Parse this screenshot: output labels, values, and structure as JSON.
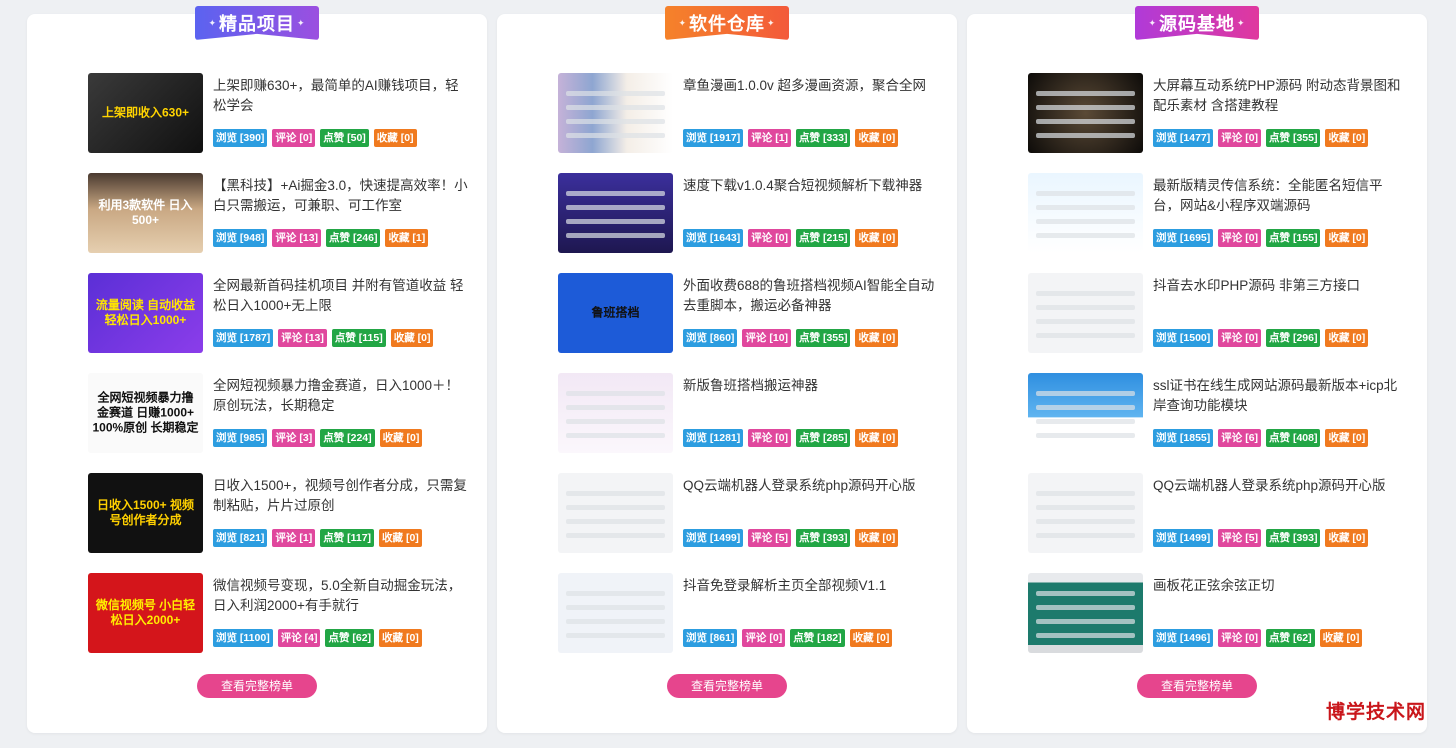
{
  "panels": [
    {
      "title": "精品项目",
      "ribbon_colors": [
        "#5b63f0",
        "#9b4fe0"
      ],
      "more_label": "查看完整榜单",
      "items": [
        {
          "title": "上架即赚630+，最简单的AI赚钱项目，轻松学会",
          "thumb_text": "上架即收入630+",
          "thumb_class": "bg-dark",
          "thumb_color": "#ffd400",
          "stats": {
            "view": "浏览 [390]",
            "comment": "评论 [0]",
            "like": "点赞 [50]",
            "fav": "收藏 [0]"
          }
        },
        {
          "title": "【黑科技】+Ai掘金3.0，快速提高效率！小白只需搬运，可兼职、可工作室",
          "thumb_text": "利用3款软件 日入500+",
          "thumb_class": "bg-desert",
          "thumb_color": "#ffffff",
          "stats": {
            "view": "浏览 [948]",
            "comment": "评论 [13]",
            "like": "点赞 [246]",
            "fav": "收藏 [1]"
          }
        },
        {
          "title": "全网最新首码挂机项目 并附有管道收益 轻松日入1000+无上限",
          "thumb_text": "流量阅读 自动收益 轻松日入1000+",
          "thumb_class": "bg-purple",
          "thumb_color": "#ffe600",
          "stats": {
            "view": "浏览 [1787]",
            "comment": "评论 [13]",
            "like": "点赞 [115]",
            "fav": "收藏 [0]"
          }
        },
        {
          "title": "全网短视频暴力撸金赛道，日入1000＋！原创玩法，长期稳定",
          "thumb_text": "全网短视频暴力撸金赛道 日赚1000+ 100%原创 长期稳定",
          "thumb_class": "bg-white",
          "thumb_color": "#111111",
          "stats": {
            "view": "浏览 [985]",
            "comment": "评论 [3]",
            "like": "点赞 [224]",
            "fav": "收藏 [0]"
          }
        },
        {
          "title": "日收入1500+，视频号创作者分成，只需复制粘贴，片片过原创",
          "thumb_text": "日收入1500+ 视频号创作者分成",
          "thumb_class": "bg-black",
          "thumb_color": "#ffd000",
          "stats": {
            "view": "浏览 [821]",
            "comment": "评论 [1]",
            "like": "点赞 [117]",
            "fav": "收藏 [0]"
          }
        },
        {
          "title": "微信视频号变现，5.0全新自动掘金玩法，日入利润2000+有手就行",
          "thumb_text": "微信视频号 小白轻松日入2000+",
          "thumb_class": "bg-red",
          "thumb_color": "#ffee00",
          "stats": {
            "view": "浏览 [1100]",
            "comment": "评论 [4]",
            "like": "点赞 [62]",
            "fav": "收藏 [0]"
          }
        }
      ]
    },
    {
      "title": "软件仓库",
      "ribbon_colors": [
        "#f5822a",
        "#f35a3a"
      ],
      "more_label": "查看完整榜单",
      "items": [
        {
          "title": "章鱼漫画1.0.0v 超多漫画资源，聚合全网",
          "thumb_text": "",
          "thumb_class": "bg-manga",
          "thumb_color": "#333333",
          "stats": {
            "view": "浏览 [1917]",
            "comment": "评论 [1]",
            "like": "点赞 [333]",
            "fav": "收藏 [0]"
          }
        },
        {
          "title": "速度下载v1.0.4聚合短视频解析下载神器",
          "thumb_text": "",
          "thumb_class": "bg-phone",
          "thumb_color": "#ffffff",
          "stats": {
            "view": "浏览 [1643]",
            "comment": "评论 [0]",
            "like": "点赞 [215]",
            "fav": "收藏 [0]"
          }
        },
        {
          "title": "外面收费688的鲁班搭档视频AI智能全自动去重脚本，搬运必备神器",
          "thumb_text": "鲁班搭档",
          "thumb_class": "bg-blue",
          "thumb_color": "#111111",
          "stats": {
            "view": "浏览 [860]",
            "comment": "评论 [10]",
            "like": "点赞 [355]",
            "fav": "收藏 [0]"
          }
        },
        {
          "title": "新版鲁班搭档搬运神器",
          "thumb_text": "",
          "thumb_class": "bg-soft",
          "thumb_color": "#333333",
          "stats": {
            "view": "浏览 [1281]",
            "comment": "评论 [0]",
            "like": "点赞 [285]",
            "fav": "收藏 [0]"
          }
        },
        {
          "title": "QQ云端机器人登录系统php源码开心版",
          "thumb_text": "",
          "thumb_class": "bg-gray",
          "thumb_color": "#333333",
          "stats": {
            "view": "浏览 [1499]",
            "comment": "评论 [5]",
            "like": "点赞 [393]",
            "fav": "收藏 [0]"
          }
        },
        {
          "title": "抖音免登录解析主页全部视频V1.1",
          "thumb_text": "",
          "thumb_class": "bg-win",
          "thumb_color": "#333333",
          "stats": {
            "view": "浏览 [861]",
            "comment": "评论 [0]",
            "like": "点赞 [182]",
            "fav": "收藏 [0]"
          }
        }
      ]
    },
    {
      "title": "源码基地",
      "ribbon_colors": [
        "#b03ad8",
        "#e0389e"
      ],
      "more_label": "查看完整榜单",
      "items": [
        {
          "title": "大屏幕互动系统PHP源码 附动态背景图和配乐素材 含搭建教程",
          "thumb_text": "",
          "thumb_class": "bg-stage",
          "thumb_color": "#ffffff",
          "stats": {
            "view": "浏览 [1477]",
            "comment": "评论 [0]",
            "like": "点赞 [355]",
            "fav": "收藏 [0]"
          }
        },
        {
          "title": "最新版精灵传信系统：全能匿名短信平台，网站&小程序双端源码",
          "thumb_text": "",
          "thumb_class": "bg-lightblue",
          "thumb_color": "#333333",
          "stats": {
            "view": "浏览 [1695]",
            "comment": "评论 [0]",
            "like": "点赞 [155]",
            "fav": "收藏 [0]"
          }
        },
        {
          "title": "抖音去水印PHP源码 非第三方接口",
          "thumb_text": "",
          "thumb_class": "bg-gray",
          "thumb_color": "#333333",
          "stats": {
            "view": "浏览 [1500]",
            "comment": "评论 [0]",
            "like": "点赞 [296]",
            "fav": "收藏 [0]"
          }
        },
        {
          "title": "ssl证书在线生成网站源码最新版本+icp北岸查询功能模块",
          "thumb_text": "",
          "thumb_class": "bg-sky",
          "thumb_color": "#ffffff",
          "stats": {
            "view": "浏览 [1855]",
            "comment": "评论 [6]",
            "like": "点赞 [408]",
            "fav": "收藏 [0]"
          }
        },
        {
          "title": "QQ云端机器人登录系统php源码开心版",
          "thumb_text": "",
          "thumb_class": "bg-gray",
          "thumb_color": "#333333",
          "stats": {
            "view": "浏览 [1499]",
            "comment": "评论 [5]",
            "like": "点赞 [393]",
            "fav": "收藏 [0]"
          }
        },
        {
          "title": "画板花正弦余弦正切",
          "thumb_text": "",
          "thumb_class": "bg-green",
          "thumb_color": "#ffffff",
          "stats": {
            "view": "浏览 [1496]",
            "comment": "评论 [0]",
            "like": "点赞 [62]",
            "fav": "收藏 [0]"
          }
        }
      ]
    }
  ],
  "watermark": "博学技术网"
}
